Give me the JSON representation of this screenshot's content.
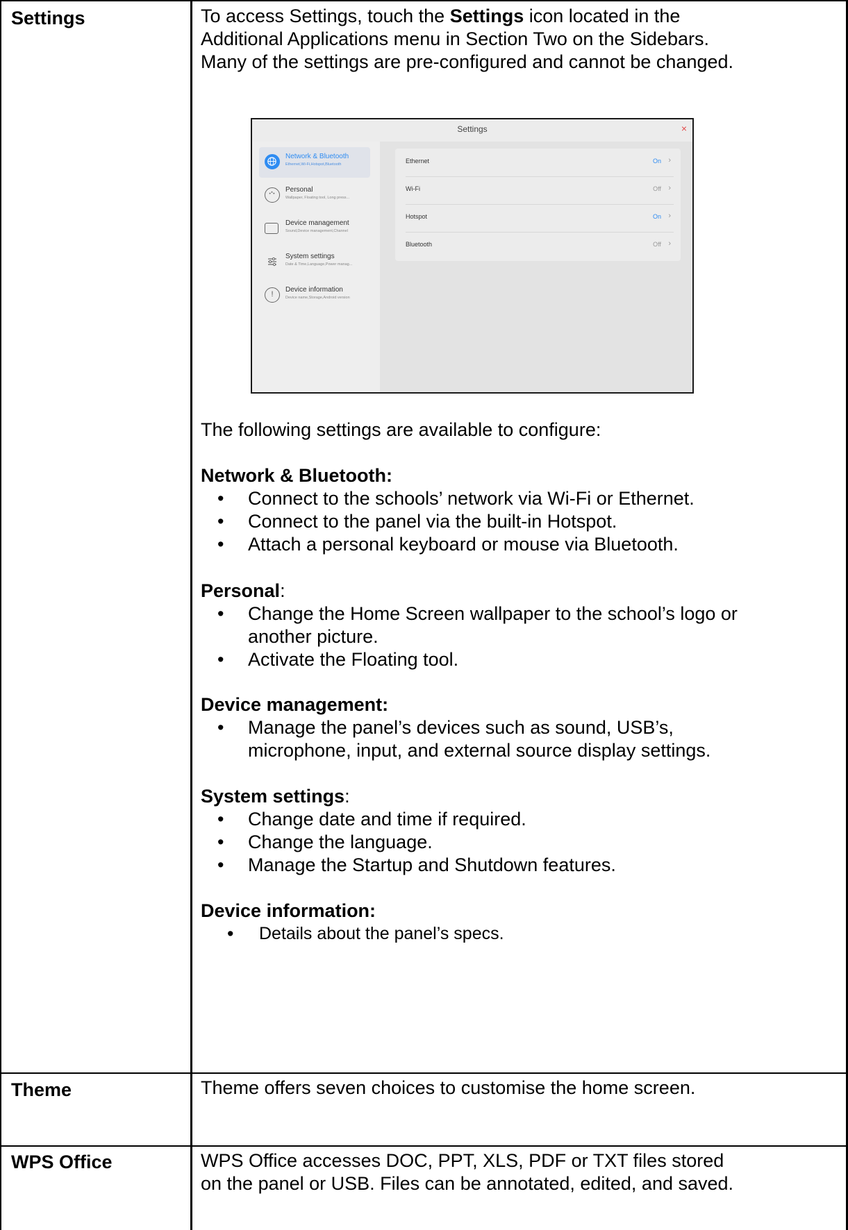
{
  "rows": [
    {
      "label": "Settings",
      "intro": {
        "pre": "To access Settings, touch the ",
        "bold": "Settings",
        "post": " icon located in the Additional Applications menu in Section Two on the Sidebars. Many of the settings are pre-configured and cannot be changed."
      },
      "available_text": "The following settings are available to configure:",
      "sections": [
        {
          "title": "Network & Bluetooth:",
          "suffix": "",
          "bullets": [
            "Connect to the schools’ network via Wi-Fi or Ethernet.",
            "Connect to the panel via the built-in Hotspot.",
            "Attach a personal keyboard or mouse via Bluetooth."
          ]
        },
        {
          "title": "Personal",
          "suffix": ":",
          "bullets": [
            "Change the Home Screen wallpaper to the school’s logo or another picture.",
            "Activate the Floating tool."
          ]
        },
        {
          "title": "Device management:",
          "suffix": "",
          "bullets": [
            "Manage the panel’s devices such as sound, USB’s, microphone, input, and external source display settings."
          ]
        },
        {
          "title": "System settings",
          "suffix": ":",
          "bullets": [
            "Change date and time if required.",
            "Change the language.",
            "Manage the Startup and Shutdown features."
          ]
        },
        {
          "title": "Device information:",
          "suffix": "",
          "bullets": [
            "Details about the panel’s specs."
          ]
        }
      ]
    },
    {
      "label": "Theme",
      "text": "Theme offers seven choices to customise the home screen."
    },
    {
      "label": "WPS Office",
      "text": "WPS Office accesses DOC, PPT, XLS, PDF or TXT files stored on the panel or USB. Files can be annotated, edited, and saved."
    }
  ],
  "screenshot": {
    "title": "Settings",
    "close_glyph": "×",
    "sidebar": [
      {
        "label": "Network & Bluetooth",
        "sub": "Ethernet,Wi-Fi,Hotspot,Bluetooth",
        "icon": "globe-icon",
        "active": true
      },
      {
        "label": "Personal",
        "sub": "Wallpaper, Floating tool, Long press...",
        "icon": "palette-icon",
        "active": false
      },
      {
        "label": "Device management",
        "sub": "Sound,Device management,Channel",
        "icon": "monitor-icon",
        "active": false
      },
      {
        "label": "System settings",
        "sub": "Date & Time,Language,Power manag...",
        "icon": "sliders-icon",
        "active": false
      },
      {
        "label": "Device information",
        "sub": "Device name,Storage,Android version",
        "icon": "info-icon",
        "active": false
      }
    ],
    "items": [
      {
        "label": "Ethernet",
        "value": "On"
      },
      {
        "label": "Wi-Fi",
        "value": "Off"
      },
      {
        "label": "Hotspot",
        "value": "On"
      },
      {
        "label": "Bluetooth",
        "value": "Off"
      }
    ],
    "chevron": "›",
    "colors": {
      "accent": "#2f8cf2",
      "close": "#e34a4a"
    }
  }
}
